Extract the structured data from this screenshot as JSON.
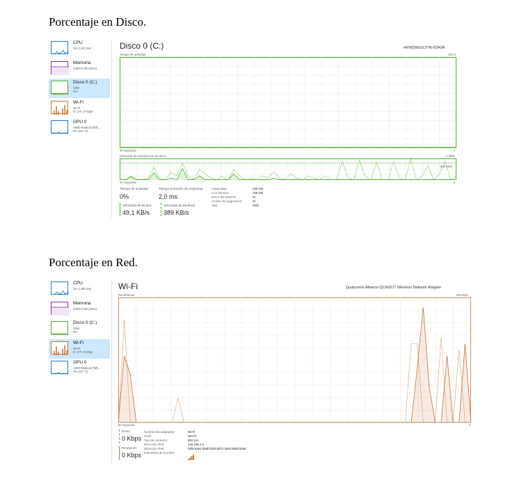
{
  "sections": {
    "disk_heading": "Porcentaje en Disco.",
    "net_heading": "Porcentaje en Red."
  },
  "colors": {
    "cpu": "#1a7bc6",
    "memory": "#8b2aa6",
    "disk": "#4bb02a",
    "wifi": "#c5743a",
    "gpu": "#1a7bc6",
    "selected_bg": "#cce8ff"
  },
  "sidebar_disk": [
    {
      "name": "CPU",
      "sub": [
        "2% 1,32 GHz"
      ],
      "icon": "cpu-graph-icon"
    },
    {
      "name": "Memoria",
      "sub": [
        "3,8/5,9 GB (64%)"
      ],
      "icon": "memory-graph-icon"
    },
    {
      "name": "Disco 0 (C:)",
      "sub": [
        "SSD",
        "0%"
      ],
      "icon": "disk-graph-icon"
    },
    {
      "name": "Wi-Fi",
      "sub": [
        "Wi-Fi",
        "E: 0 R: 0 Kbps"
      ],
      "icon": "wifi-graph-icon"
    },
    {
      "name": "GPU 0",
      "sub": [
        "AMD Radeon(TM) ...",
        "0% (43 °C)"
      ],
      "icon": "gpu-graph-icon"
    }
  ],
  "sidebar_net": [
    {
      "name": "CPU",
      "sub": [
        "2% 1,38 GHz"
      ],
      "icon": "cpu-graph-icon"
    },
    {
      "name": "Memoria",
      "sub": [
        "3,8/5,9 GB (64%)"
      ],
      "icon": "memory-graph-icon"
    },
    {
      "name": "Disco 0 (C:)",
      "sub": [
        "SSD",
        "0%"
      ],
      "icon": "disk-graph-icon"
    },
    {
      "name": "Wi-Fi",
      "sub": [
        "Wi-Fi",
        "E: 0 R: 0 Kbps"
      ],
      "icon": "wifi-graph-icon"
    },
    {
      "name": "GPU 0",
      "sub": [
        "AMD Radeon(TM) ...",
        "0% (44 °C)"
      ],
      "icon": "gpu-graph-icon"
    }
  ],
  "disk": {
    "title": "Disco 0 (C:)",
    "model": "HFM256GDJTNI-82A0A",
    "activity_label": "Tiempo de actividad",
    "activity_max": "100 %",
    "activity_xlabel": "60 segundos",
    "activity_min": "0",
    "transfer_label": "Velocidad de transferencia de disco",
    "transfer_max": "1 MB/s",
    "transfer_mid": "800 KB/s",
    "transfer_xlabel": "60 segundos",
    "transfer_min": "0",
    "stats": {
      "activity_time_label": "Tiempo de actividad",
      "activity_time": "0%",
      "avg_response_label": "Tiempo promedio de respuesta",
      "avg_response": "2,0 ms",
      "read_label": "Velocidad de lectura",
      "read": "49,1 KB/s",
      "write_label": "Velocidad de escritura",
      "write": "389 KB/s"
    },
    "props": [
      {
        "k": "Capacidad:",
        "v": "239 GB"
      },
      {
        "k": "Con formato:",
        "v": "239 GB"
      },
      {
        "k": "Disco del sistema:",
        "v": "Sí"
      },
      {
        "k": "Archivo de paginación:",
        "v": "Sí"
      },
      {
        "k": "Tipo:",
        "v": "SSD"
      }
    ],
    "activity_series": [
      0,
      0,
      0,
      0,
      0,
      0,
      0,
      0,
      0,
      0,
      0,
      0,
      0,
      0,
      0,
      0,
      0,
      0,
      0,
      0,
      0,
      0,
      0,
      0,
      0,
      0,
      0,
      0,
      0,
      0,
      0,
      0,
      0,
      0,
      0,
      0,
      0,
      0,
      0,
      0,
      0,
      0,
      0,
      0,
      0,
      0,
      0,
      0,
      0,
      0,
      0,
      0,
      0,
      0,
      0,
      0,
      0,
      0,
      0,
      0
    ],
    "read_series": [
      0,
      0,
      0.15,
      0,
      0,
      0,
      0.35,
      0,
      0,
      0.1,
      0,
      0.55,
      0,
      0,
      0.2,
      0,
      0,
      0,
      0,
      0,
      0.3,
      0,
      0,
      0,
      0,
      0,
      0,
      0.1,
      0,
      0,
      0,
      0,
      0,
      0,
      0,
      0,
      0,
      0,
      0,
      0,
      0,
      0,
      0,
      0,
      0,
      0,
      0,
      0,
      0,
      0,
      0,
      0,
      0,
      0,
      0,
      0,
      0,
      0,
      0,
      0
    ],
    "write_series": [
      0,
      0,
      0.2,
      0.05,
      0,
      0.1,
      0.6,
      0.1,
      0,
      0.4,
      0.2,
      0.8,
      0.2,
      0,
      0.5,
      0.3,
      0.1,
      0,
      0.2,
      0,
      0.5,
      0.2,
      0,
      0.1,
      0,
      0.2,
      0.1,
      0.4,
      0.1,
      0,
      0.3,
      0.1,
      0,
      0.2,
      0.1,
      0,
      0.2,
      0,
      0,
      0.9,
      0.1,
      0,
      0.95,
      0.2,
      0,
      0.85,
      0,
      0,
      0.9,
      0.1,
      0,
      1,
      0,
      0.2,
      0.7,
      0,
      0.3,
      0.9,
      0,
      0.2
    ]
  },
  "net": {
    "title": "Wi-Fi",
    "adapter": "Qualcomm Atheros QCA9377 Wireless Network Adapter",
    "graph_label": "Rendimiento",
    "graph_max": "100 Kbps",
    "graph_xlabel": "60 segundos",
    "graph_min": "0",
    "send_label": "Envío",
    "send": "0 Kbps",
    "recv_label": "Recepción",
    "recv": "0 Kbps",
    "props": [
      {
        "k": "Nombre del adaptador:",
        "v": "Wi-Fi"
      },
      {
        "k": "SSID:",
        "v": "MAYIT"
      },
      {
        "k": "Tipo de conexión:",
        "v": "802.11n"
      },
      {
        "k": "Dirección IPv4:",
        "v": "192.168.1.2"
      },
      {
        "k": "Dirección IPv6:",
        "v": "fd08:6361:55ab:fc00:d072:3e54:5883:8ca0"
      },
      {
        "k": "Intensidad de la señal:",
        "v": ""
      }
    ],
    "signal_bars": 4,
    "send_series": [
      0,
      0.85,
      0,
      0,
      0,
      0,
      0,
      0,
      0,
      0,
      0.2,
      0,
      0,
      0,
      0,
      0,
      0,
      0,
      0,
      0,
      0,
      0,
      0,
      0,
      0,
      0,
      0,
      0,
      0,
      0,
      0,
      0,
      0,
      0,
      0,
      0,
      0,
      0,
      0,
      0,
      0,
      0,
      0,
      0,
      0,
      0,
      0,
      0,
      0,
      0.65,
      0.65,
      0,
      0,
      0,
      0.7,
      0,
      0,
      0.6,
      0,
      0
    ],
    "recv_series": [
      0,
      0.55,
      0.4,
      0,
      0,
      0,
      0,
      0,
      0,
      0,
      0,
      0,
      0,
      0,
      0,
      0,
      0,
      0,
      0,
      0,
      0,
      0,
      0,
      0,
      0,
      0,
      0,
      0,
      0,
      0,
      0,
      0,
      0,
      0,
      0,
      0,
      0,
      0,
      0,
      0,
      0,
      0,
      0,
      0,
      0,
      0,
      0,
      0,
      0,
      0,
      0.45,
      0.95,
      0.3,
      0,
      0,
      0.55,
      0,
      0,
      0.65,
      0
    ]
  }
}
